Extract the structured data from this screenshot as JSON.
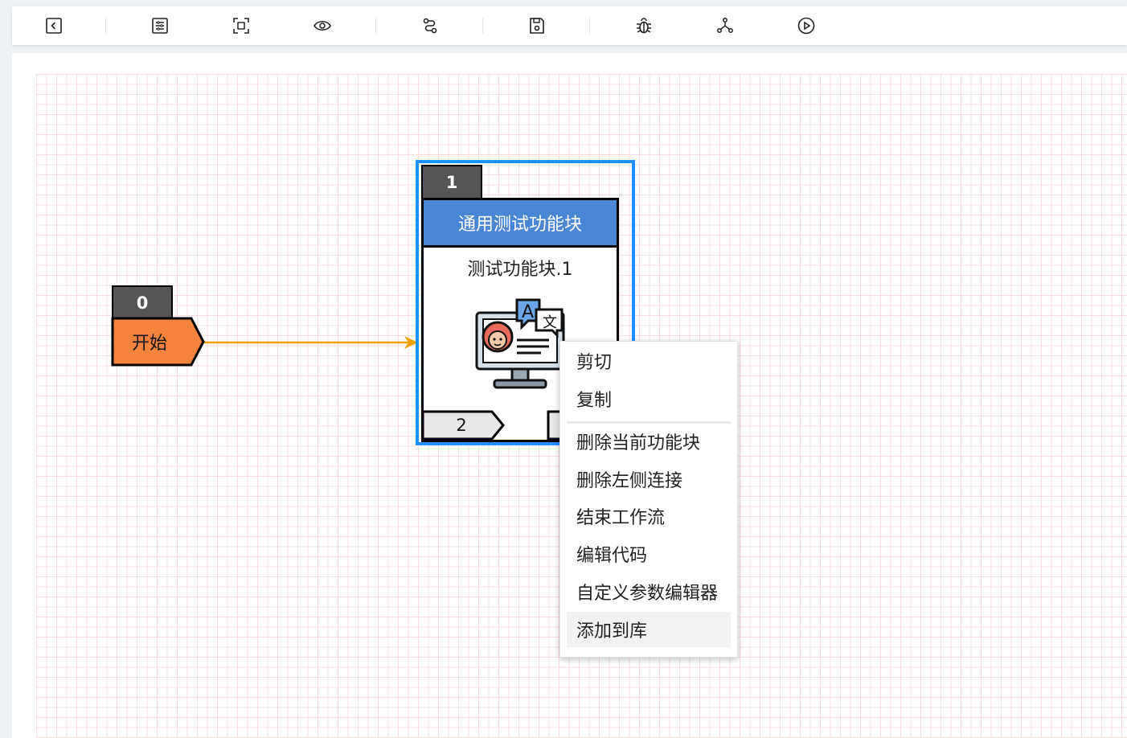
{
  "toolbar": {
    "buttons": [
      {
        "icon": "back-arrow-square-icon"
      },
      {
        "icon": "sliders-settings-icon"
      },
      {
        "icon": "fit-screen-icon"
      },
      {
        "icon": "eye-preview-icon"
      },
      {
        "icon": "route-path-icon"
      },
      {
        "icon": "save-floppy-icon"
      },
      {
        "icon": "bug-debug-icon"
      },
      {
        "icon": "network-nodes-icon"
      },
      {
        "icon": "play-run-icon"
      }
    ]
  },
  "canvas": {
    "start_node": {
      "index": "0",
      "label": "开始",
      "color": "#f4843d"
    },
    "block_node": {
      "index": "1",
      "header": "通用测试功能块",
      "name": "测试功能块.1",
      "port_left": "2",
      "header_color": "#4a86d6",
      "selection_color": "#1e90ff"
    },
    "connection_color": "#f0a000"
  },
  "context_menu": {
    "items": [
      {
        "label": "剪切"
      },
      {
        "label": "复制"
      },
      {
        "label": "删除当前功能块"
      },
      {
        "label": "删除左侧连接"
      },
      {
        "label": "结束工作流"
      },
      {
        "label": "编辑代码"
      },
      {
        "label": "自定义参数编辑器"
      },
      {
        "label": "添加到库"
      }
    ],
    "hovered_item": "添加到库"
  }
}
